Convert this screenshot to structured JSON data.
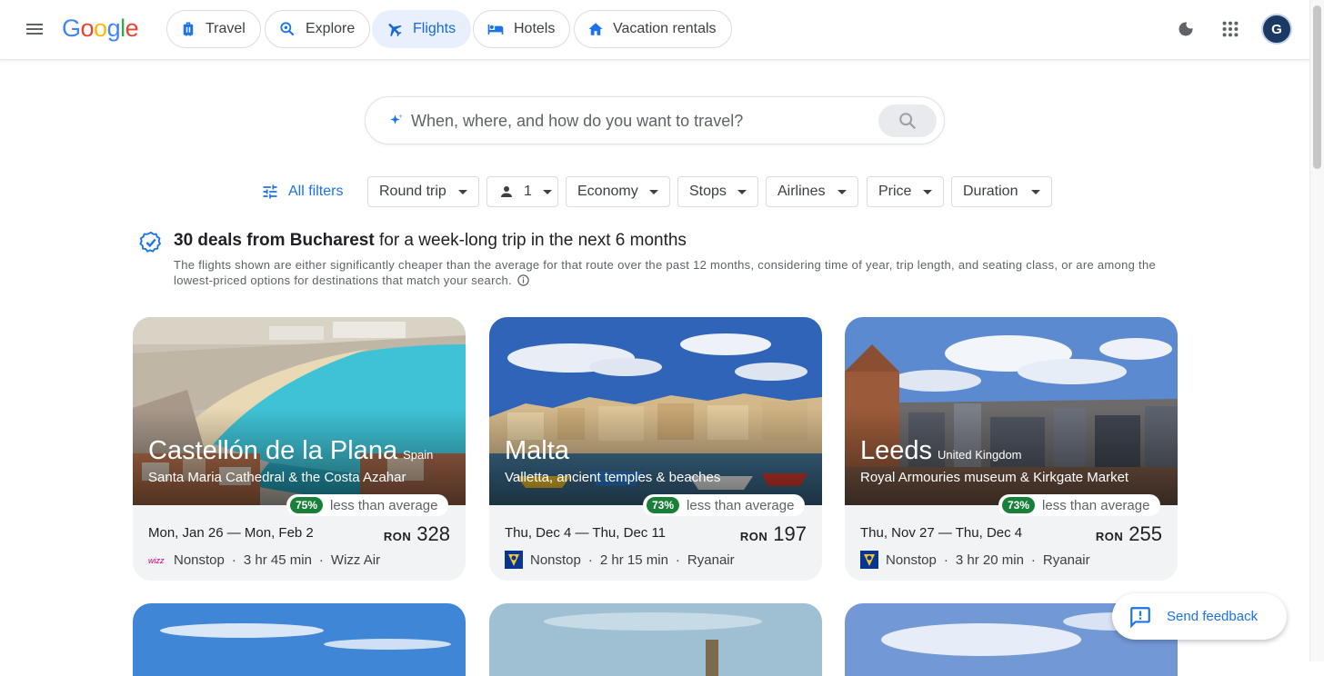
{
  "header": {
    "logo": [
      "G",
      "o",
      "o",
      "g",
      "l",
      "e"
    ],
    "logo_colors": [
      "#4285F4",
      "#EA4335",
      "#FBBC05",
      "#4285F4",
      "#34A853",
      "#EA4335"
    ],
    "nav": [
      {
        "label": "Travel"
      },
      {
        "label": "Explore"
      },
      {
        "label": "Flights",
        "active": true
      },
      {
        "label": "Hotels"
      },
      {
        "label": "Vacation rentals"
      }
    ],
    "avatar_letter": "G"
  },
  "search": {
    "placeholder": "When, where, and how do you want to travel?"
  },
  "filters": {
    "all_filters": "All filters",
    "chips": [
      "Round trip",
      "1",
      "Economy",
      "Stops",
      "Airlines",
      "Price",
      "Duration"
    ]
  },
  "deals": {
    "title_bold": "30 deals from Bucharest",
    "title_rest": " for a week-long trip in the next 6 months",
    "description": "The flights shown are either significantly cheaper than the average for that route over the past 12 months, considering time of year, trip length, and seating class, or are among the lowest-priced options for destinations that match your search."
  },
  "cards": [
    {
      "city": "Castellón de la Plana",
      "country": "Spain",
      "subtitle": "Santa Maria Cathedral & the Costa Azahar",
      "percent": "75%",
      "badge_text": "less than average",
      "dates": "Mon, Jan 26 — Mon, Feb 2",
      "currency": "RON",
      "price": "328",
      "stops": "Nonstop",
      "duration": "3 hr 45 min",
      "airline": "Wizz Air"
    },
    {
      "city": "Malta",
      "country": "",
      "subtitle": "Valletta, ancient temples & beaches",
      "percent": "73%",
      "badge_text": "less than average",
      "dates": "Thu, Dec 4 — Thu, Dec 11",
      "currency": "RON",
      "price": "197",
      "stops": "Nonstop",
      "duration": "2 hr 15 min",
      "airline": "Ryanair"
    },
    {
      "city": "Leeds",
      "country": "United Kingdom",
      "subtitle": "Royal Armouries museum & Kirkgate Market",
      "percent": "73%",
      "badge_text": "less than average",
      "dates": "Thu, Nov 27 — Thu, Dec 4",
      "currency": "RON",
      "price": "255",
      "stops": "Nonstop",
      "duration": "3 hr 20 min",
      "airline": "Ryanair"
    }
  ],
  "feedback": {
    "label": "Send feedback"
  },
  "colors": {
    "accent": "#1a73e8",
    "active_tab_bg": "#e8f0fe",
    "deal_green": "#188038"
  }
}
